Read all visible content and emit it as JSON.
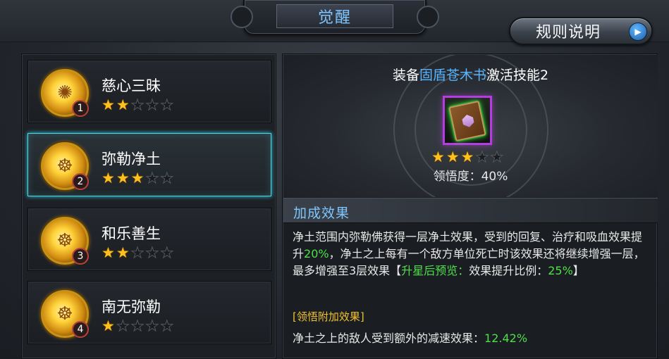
{
  "title": "觉醒",
  "rules_button": {
    "label": "规则说明",
    "icon": "play-arrow-icon"
  },
  "skills": [
    {
      "name": "慈心三昧",
      "number": "1",
      "stars": 2,
      "max_stars": 5,
      "selected": false
    },
    {
      "name": "弥勒净土",
      "number": "2",
      "stars": 3,
      "max_stars": 5,
      "selected": true
    },
    {
      "name": "和乐善生",
      "number": "3",
      "stars": 2,
      "max_stars": 5,
      "selected": false
    },
    {
      "name": "南无弥勒",
      "number": "4",
      "stars": 1,
      "max_stars": 5,
      "selected": false
    }
  ],
  "detail": {
    "equip_prefix": "装备",
    "equip_item": "固盾苍木书",
    "equip_suffix": "激活技能2",
    "item_icon": "book-icon",
    "stars": 3,
    "max_stars": 5,
    "understanding": "领悟度：40%",
    "bonus_title": "加成效果",
    "bonus_text_1": "净土范围内弥勒佛获得一层净土效果，受到的回复、治疗和吸血效果提升",
    "bonus_value_1": "20%",
    "bonus_text_2": "，净土之上每有一个敌方单位死亡时该效果还将继续增强一层，最多增强至3层效果【",
    "preview_label": "升星后预览：",
    "bonus_text_3": "效果提升比例：",
    "bonus_value_2": "25%",
    "bonus_text_4": "】",
    "extra_title": "[领悟附加效果]",
    "extra_text": "净土之上的敌人受到额外的减速效果：",
    "extra_value": "12.42%"
  },
  "colors": {
    "accent_blue": "#7fc6ff",
    "star_gold": "#ffbf1f",
    "highlight_green": "#4ee04a",
    "selection_cyan": "#4fd6e6",
    "item_purple": "#b43ce0"
  }
}
